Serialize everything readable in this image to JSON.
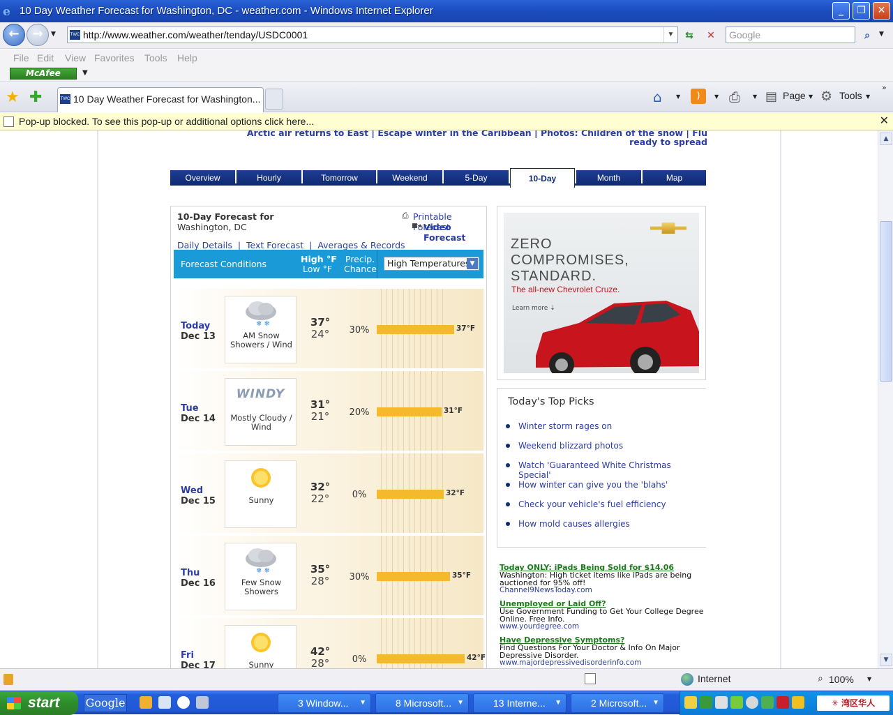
{
  "window": {
    "title": "10 Day Weather Forecast for Washington, DC - weather.com - Windows Internet Explorer"
  },
  "address": {
    "url": "http://www.weather.com/weather/tenday/USDC0001",
    "search_placeholder": "Google",
    "favicon": "TWC"
  },
  "menu": [
    "File",
    "Edit",
    "View",
    "Favorites",
    "Tools",
    "Help"
  ],
  "mcafee_label": "McAfee",
  "tab": {
    "label": "10 Day Weather Forecast for Washington..."
  },
  "commandbar": {
    "page": "Page",
    "tools": "Tools"
  },
  "popup_bar": {
    "text": "Pop-up blocked. To see this pop-up or additional options click here...",
    "close": "✕"
  },
  "headlines": [
    "Arctic air returns to East",
    "Escape winter in the Caribbean",
    "Photos: Children of the snow",
    "Flu ready to spread"
  ],
  "nav_tabs": [
    "Overview",
    "Hourly",
    "Tomorrow",
    "Weekend",
    "5-Day",
    "10-Day",
    "Month",
    "Map"
  ],
  "active_tab": "10-Day",
  "forecast": {
    "title": "10-Day Forecast for",
    "location": "Washington, DC",
    "printable": "Printable Forecast",
    "video": "Video Forecast",
    "links": [
      "Daily Details",
      "Text Forecast",
      "Averages & Records"
    ],
    "header": {
      "conditions": "Forecast Conditions",
      "high": "High °F",
      "low": "Low °F",
      "precip1": "Precip.",
      "precip2": "Chance",
      "select": "High Temperatures"
    },
    "days": [
      {
        "day": "Today",
        "date": "Dec 13",
        "cond": "AM Snow Showers / Wind",
        "icon": "snow-cloud-icon",
        "high": "37°",
        "low": "24°",
        "precip": "30%",
        "bar_label": "37°F",
        "bar_value": 37
      },
      {
        "day": "Tue",
        "date": "Dec 14",
        "cond": "Mostly Cloudy / Wind",
        "icon": "windy-icon",
        "icon_text": "WINDY",
        "high": "31°",
        "low": "21°",
        "precip": "20%",
        "bar_label": "31°F",
        "bar_value": 31
      },
      {
        "day": "Wed",
        "date": "Dec 15",
        "cond": "Sunny",
        "icon": "sun-icon",
        "high": "32°",
        "low": "22°",
        "precip": "0%",
        "bar_label": "32°F",
        "bar_value": 32
      },
      {
        "day": "Thu",
        "date": "Dec 16",
        "cond": "Few Snow Showers",
        "icon": "snow-cloud-icon",
        "high": "35°",
        "low": "28°",
        "precip": "30%",
        "bar_label": "35°F",
        "bar_value": 35
      },
      {
        "day": "Fri",
        "date": "Dec 17",
        "cond": "Sunny",
        "icon": "sun-icon",
        "high": "42°",
        "low": "28°",
        "precip": "0%",
        "bar_label": "42°F",
        "bar_value": 42
      }
    ],
    "bar_scale_max": 50,
    "bar_color": "#f4b92d"
  },
  "ad": {
    "line1": "ZERO",
    "line2": "COMPROMISES,",
    "line3": "STANDARD.",
    "line4": "The all-new Chevrolet Cruze.",
    "learn": "Learn more"
  },
  "picks": {
    "title": "Today's Top Picks",
    "items": [
      "Winter storm rages on",
      "Weekend blizzard photos",
      "Watch 'Guaranteed White Christmas Special'",
      "How winter can give you the 'blahs'",
      "Check your vehicle's fuel efficiency",
      "How mold causes allergies"
    ]
  },
  "sponsored": [
    {
      "head": "Today ONLY: iPads Being Sold for $14.06",
      "body": "Washington: High ticket items like iPads are being auctioned for 95% off!",
      "url": "Channel9NewsToday.com"
    },
    {
      "head": "Unemployed or Laid Off?",
      "body": "Use Government Funding to Get Your College Degree Online. Free Info.",
      "url": "www.yourdegree.com"
    },
    {
      "head": "Have Depressive Symptoms?",
      "body": "Find Questions For Your Doctor & Info On Major Depressive Disorder.",
      "url": "www.majordepressivedisorderinfo.com"
    }
  ],
  "status": {
    "zone": "Internet",
    "zoom": "100%"
  },
  "taskbar": {
    "start": "start",
    "google": "Google",
    "buttons": [
      "3 Window...",
      "8 Microsoft...",
      "13 Interne...",
      "2 Microsoft..."
    ],
    "tray_text": "湾区华人"
  }
}
